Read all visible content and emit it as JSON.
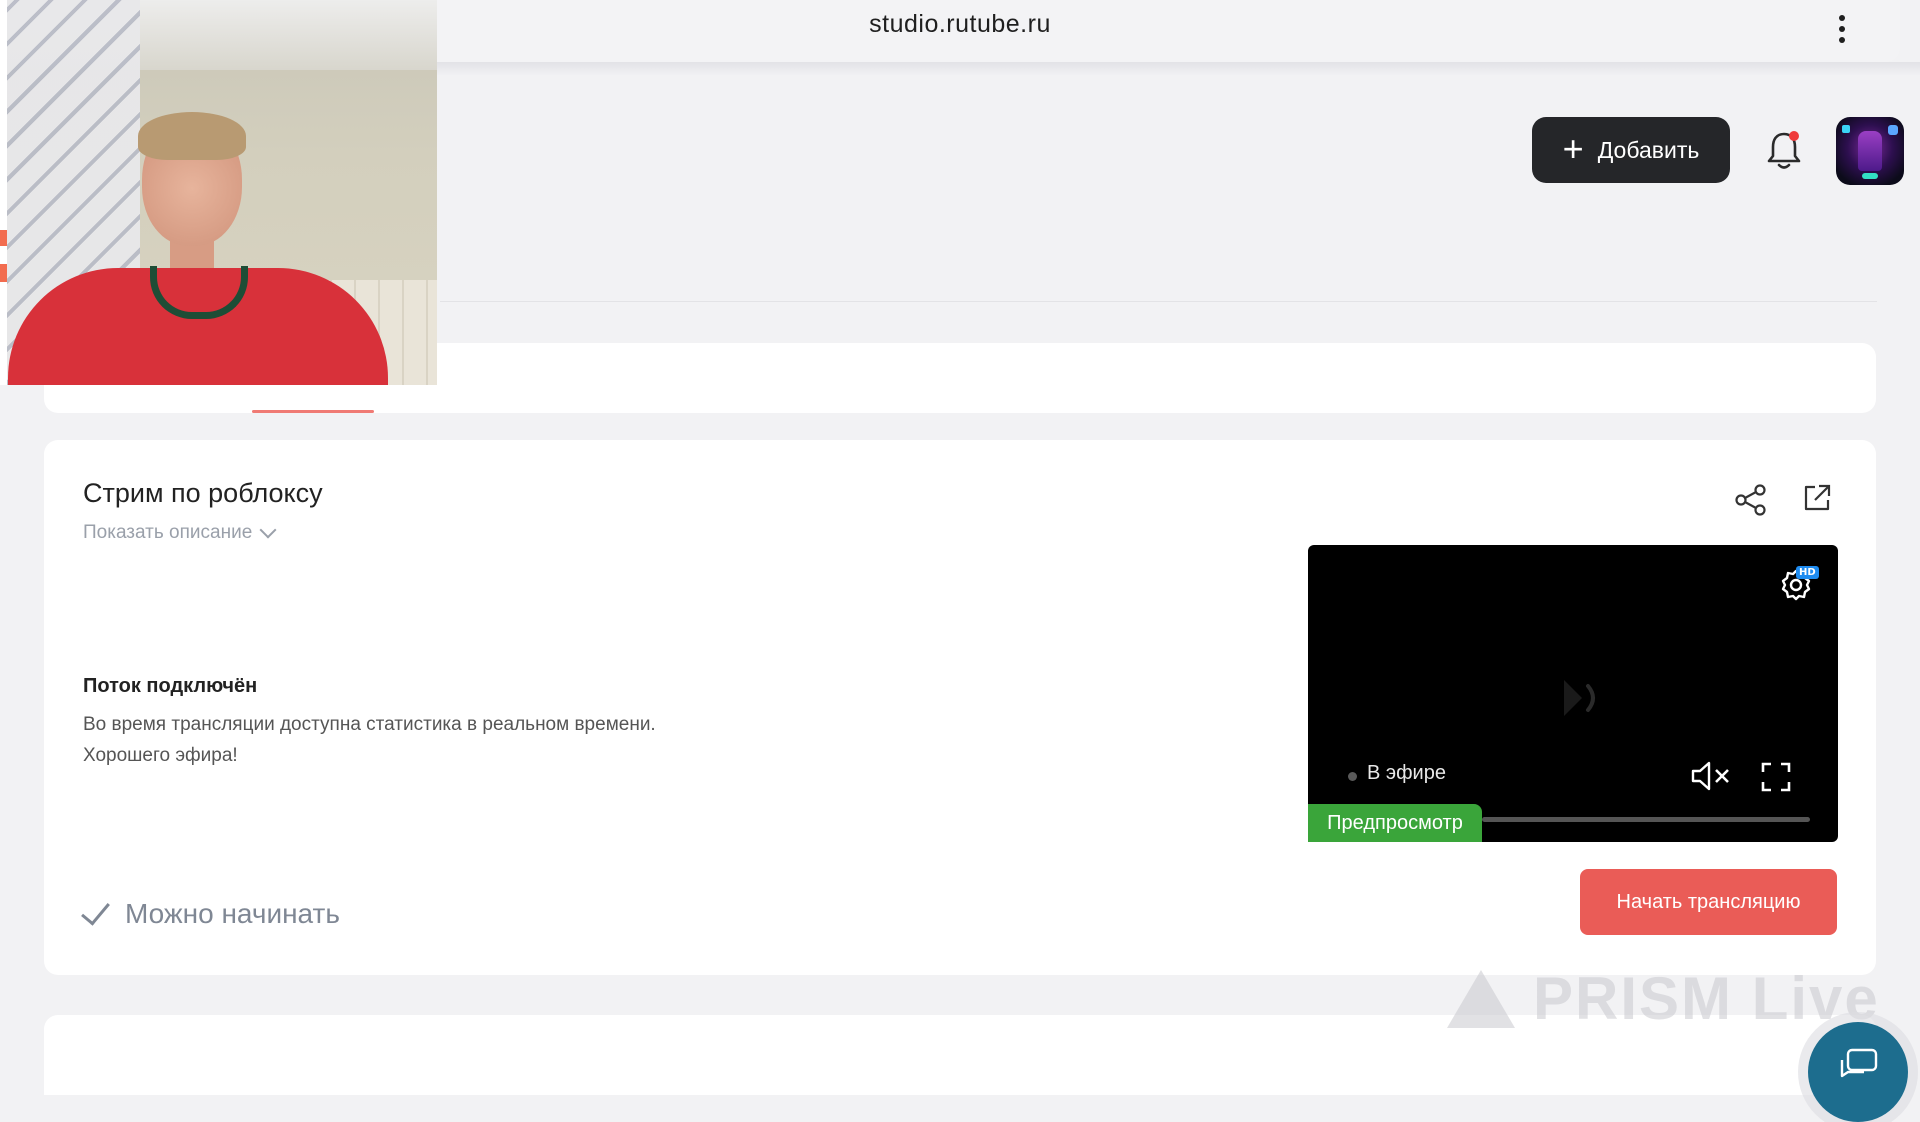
{
  "browser": {
    "url": "studio.rutube.ru"
  },
  "header": {
    "add_label": "Добавить"
  },
  "stream": {
    "title": "Стрим по роблоксу",
    "show_description": "Показать описание",
    "status_title": "Поток подключён",
    "status_line1": "Во время трансляции доступна статистика в реальном времени.",
    "status_line2": "Хорошего эфира!",
    "ready_label": "Можно начинать",
    "start_button": "Начать трансляцию"
  },
  "player": {
    "live_label": "В эфире",
    "quality_badge": "HD",
    "preview_label": "Предпросмотр"
  },
  "watermark": {
    "text": "PRISM Live"
  },
  "colors": {
    "accent_red": "#ea5c57",
    "preview_green": "#3aa53a",
    "dark_button": "#252629",
    "chat_fab": "#1d6d8e"
  },
  "icons": [
    "kebab-menu-icon",
    "plus-icon",
    "bell-icon",
    "share-icon",
    "external-link-icon",
    "chevron-down-icon",
    "settings-gear-icon",
    "play-icon",
    "mute-icon",
    "fullscreen-icon",
    "check-icon",
    "chat-icon"
  ]
}
